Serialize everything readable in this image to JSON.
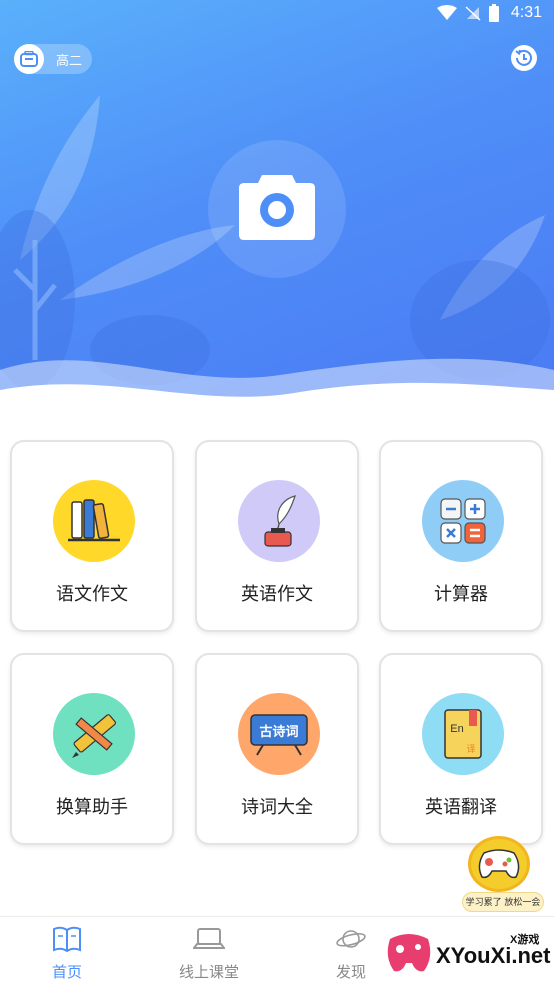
{
  "status_bar": {
    "time": "4:31"
  },
  "header": {
    "grade": "高二"
  },
  "tools": [
    {
      "label": "语文作文",
      "icon": "books-icon",
      "bg": "#ffd829"
    },
    {
      "label": "英语作文",
      "icon": "quill-pen-icon",
      "bg": "#cfcaf8"
    },
    {
      "label": "计算器",
      "icon": "calculator-icon",
      "bg": "#8fcdf7"
    },
    {
      "label": "换算助手",
      "icon": "ruler-pencil-icon",
      "bg": "#6fe0c0"
    },
    {
      "label": "诗词大全",
      "icon": "poetry-board-icon",
      "bg": "#ffa66b"
    },
    {
      "label": "英语翻译",
      "icon": "dictionary-icon",
      "bg": "#8fdcf5"
    }
  ],
  "poetry_board_text": "古诗词",
  "dictionary_text": {
    "top": "En",
    "bottom": "译"
  },
  "game_bubble": {
    "caption": "学习累了 放松一会"
  },
  "bottom_nav": [
    {
      "label": "首页",
      "icon": "book-open-icon",
      "active": true
    },
    {
      "label": "线上课堂",
      "icon": "laptop-icon",
      "active": false
    },
    {
      "label": "发现",
      "icon": "planet-icon",
      "active": false
    }
  ],
  "watermark": {
    "sub": "X游戏",
    "main": "XYouXi.net"
  },
  "colors": {
    "accent": "#4d8ff7",
    "hero_top": "#5ab0fb",
    "hero_bottom": "#4a79f3"
  }
}
